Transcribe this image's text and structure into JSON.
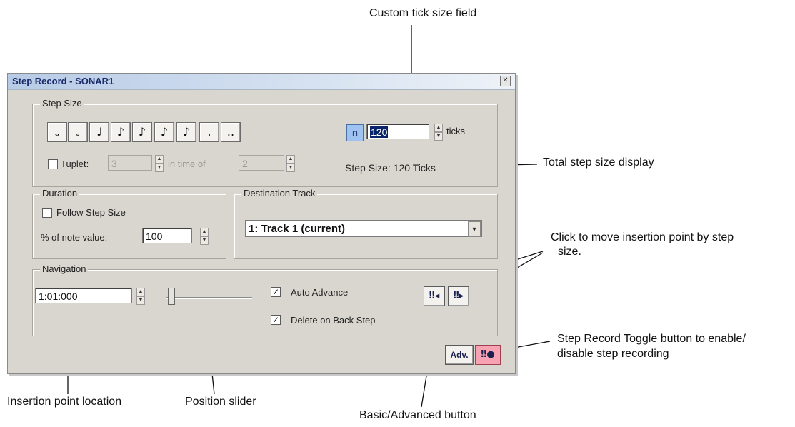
{
  "callouts": {
    "custom_tick": "Custom tick size field",
    "total_step": "Total step size display",
    "click_move_1": "Click to move insertion point by step",
    "click_move_2": "size.",
    "toggle_1": "Step Record Toggle button to enable/",
    "toggle_2": "disable step recording",
    "insertion": "Insertion point location",
    "slider": "Position slider",
    "basic_adv": "Basic/Advanced button"
  },
  "dialog": {
    "title": "Step Record - SONAR1",
    "close_glyph": "✕"
  },
  "step_size": {
    "legend": "Step Size",
    "note_buttons": [
      "𝅝",
      "𝅗𝅥",
      "♩",
      "♪",
      "♪",
      "♪",
      "♪",
      ".",
      ".."
    ],
    "n_label": "n",
    "ticks_value": "120",
    "ticks_label": "ticks",
    "tuplet_label": "Tuplet:",
    "tuplet_value": "3",
    "in_time_of": "in time of",
    "tuplet_of_value": "2",
    "display": "Step Size: 120 Ticks"
  },
  "duration": {
    "legend": "Duration",
    "follow_label": "Follow Step Size",
    "pct_label": "% of note value:",
    "pct_value": "100"
  },
  "destination": {
    "legend": "Destination Track",
    "selected": "1: Track 1 (current)"
  },
  "navigation": {
    "legend": "Navigation",
    "location": "1:01:000",
    "auto_advance": "Auto Advance",
    "delete_back": "Delete on Back Step",
    "step_back_glyph": "‼◂",
    "step_fwd_glyph": "‼▸"
  },
  "bottom": {
    "adv_label": "Adv.",
    "toggle_glyph": "‼●"
  },
  "checks": {
    "checked": "✓"
  },
  "colors": {
    "dialog_bg": "#d9d6cf",
    "toggle_bg": "#f7a3b4",
    "n_button_bg": "#9ec3f0"
  },
  "icons": {
    "spin": [
      "spin-up-icon",
      "spin-down-icon"
    ],
    "dropdown": "chevron-down-icon"
  }
}
